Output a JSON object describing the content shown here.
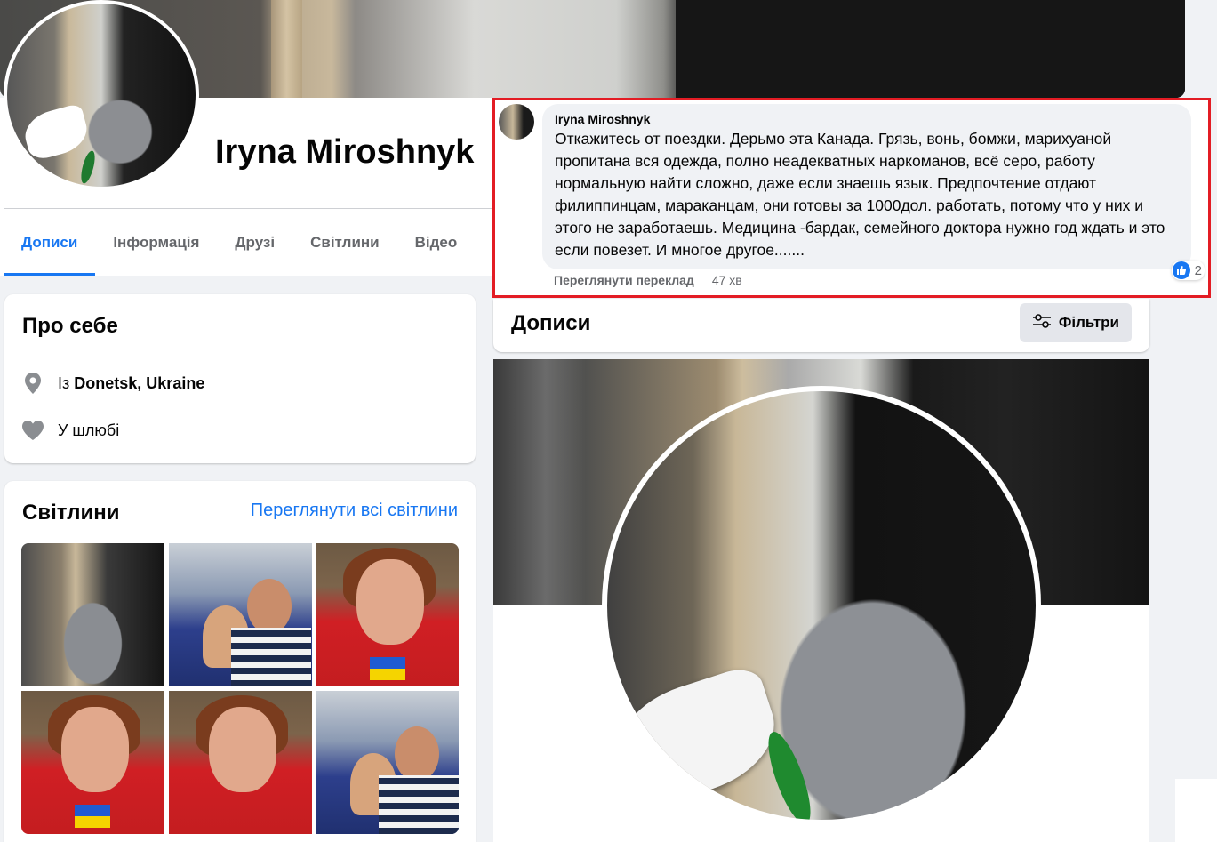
{
  "profile": {
    "name": "Iryna Miroshnyk",
    "tabs": [
      "Дописи",
      "Інформація",
      "Друзі",
      "Світлини",
      "Відео"
    ]
  },
  "about": {
    "title": "Про себе",
    "from_prefix": "Із",
    "from_place": "Donetsk, Ukraine",
    "relationship": "У шлюбі"
  },
  "photos": {
    "title": "Світлини",
    "see_all": "Переглянути всі світлини"
  },
  "comment": {
    "author": "Iryna Miroshnyk",
    "text": "Откажитесь от поездки. Дерьмо эта Канада. Грязь, вонь, бомжи, марихуаной пропитана вся одежда, полно неадекватных наркоманов, всё серо, работу нормальную найти сложно, даже если знаешь язык. Предпочтение отдают филиппинцам, мараканцам, они готовы за 1000дол. работать, потому что у них и этого не заработаешь. Медицина -бардак, семейного доктора нужно год ждать и это если повезет. И многое другое.......",
    "translate": "Переглянути переклад",
    "time": "47 хв",
    "reaction_count": "2"
  },
  "posts": {
    "title": "Дописи",
    "filters": "Фільтри"
  },
  "colors": {
    "accent": "#1877f2",
    "highlight_border": "#e31c24"
  }
}
